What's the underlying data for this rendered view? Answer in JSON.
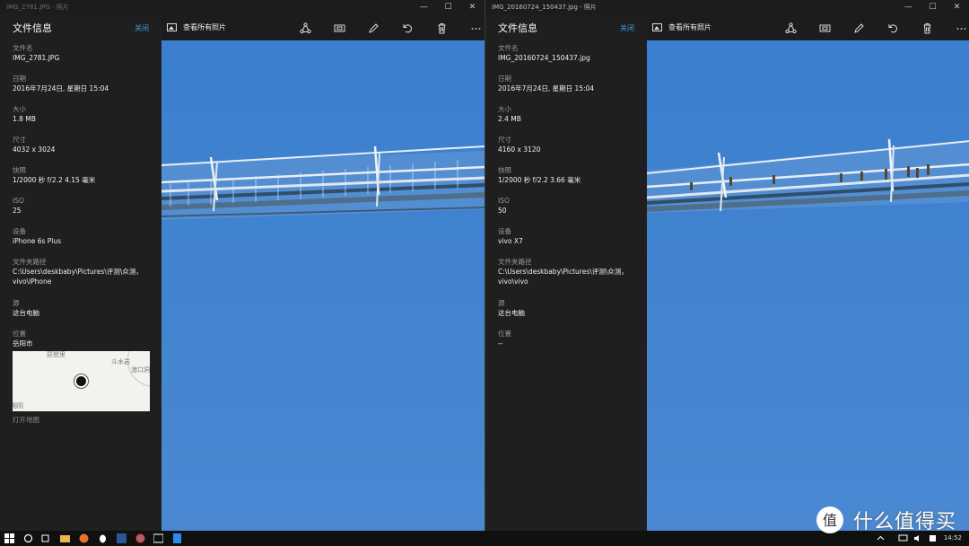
{
  "left": {
    "title_bar": "IMG_2781.JPG - 照片",
    "panel": {
      "title": "文件信息",
      "close_label": "关闭",
      "fields": [
        {
          "label": "文件名",
          "value": "IMG_2781.JPG"
        },
        {
          "label": "日期",
          "value": "2016年7月24日, 星期日 15:04"
        },
        {
          "label": "大小",
          "value": "1.8 MB"
        },
        {
          "label": "尺寸",
          "value": "4032 x 3024"
        },
        {
          "label": "快照",
          "value": "1/2000 秒 f/2.2 4.15 毫米"
        },
        {
          "label": "ISO",
          "value": "25"
        },
        {
          "label": "设备",
          "value": "iPhone 6s Plus"
        },
        {
          "label": "文件夹路径",
          "value": "C:\\Users\\deskbaby\\Pictures\\评测\\众测，",
          "value2": "vivo\\iPhone"
        },
        {
          "label": "源",
          "value": "这台电脑"
        },
        {
          "label": "位置",
          "value": "岳阳市"
        }
      ],
      "map_labels": [
        "琵琶里",
        "斗水岩",
        "港口洞",
        "湘阴"
      ],
      "open_map": "打开地图"
    },
    "toolbar": {
      "view_all": "查看所有照片"
    }
  },
  "right": {
    "title_bar": "IMG_20160724_150437.jpg - 照片",
    "panel": {
      "title": "文件信息",
      "close_label": "关闭",
      "fields": [
        {
          "label": "文件名",
          "value": "IMG_20160724_150437.jpg"
        },
        {
          "label": "日期",
          "value": "2016年7月24日, 星期日 15:04"
        },
        {
          "label": "大小",
          "value": "2.4 MB"
        },
        {
          "label": "尺寸",
          "value": "4160 x 3120"
        },
        {
          "label": "快照",
          "value": "1/2000 秒 f/2.2 3.66 毫米"
        },
        {
          "label": "ISO",
          "value": "50"
        },
        {
          "label": "设备",
          "value": "vivo X7"
        },
        {
          "label": "文件夹路径",
          "value": "C:\\Users\\deskbaby\\Pictures\\评测\\众测，",
          "value2": "vivo\\vivo"
        },
        {
          "label": "源",
          "value": "这台电脑"
        },
        {
          "label": "位置",
          "value": "--"
        }
      ]
    },
    "toolbar": {
      "view_all": "查看所有照片"
    }
  },
  "window_buttons": {
    "minimize": "—",
    "maximize": "☐",
    "close": "✕"
  },
  "taskbar": {
    "clock": "14:52"
  },
  "watermark": {
    "text": "什么值得买"
  },
  "colors": {
    "accent": "#3f9bdc",
    "panel_bg": "#1f1f1f",
    "sky": "#3f82cf"
  }
}
